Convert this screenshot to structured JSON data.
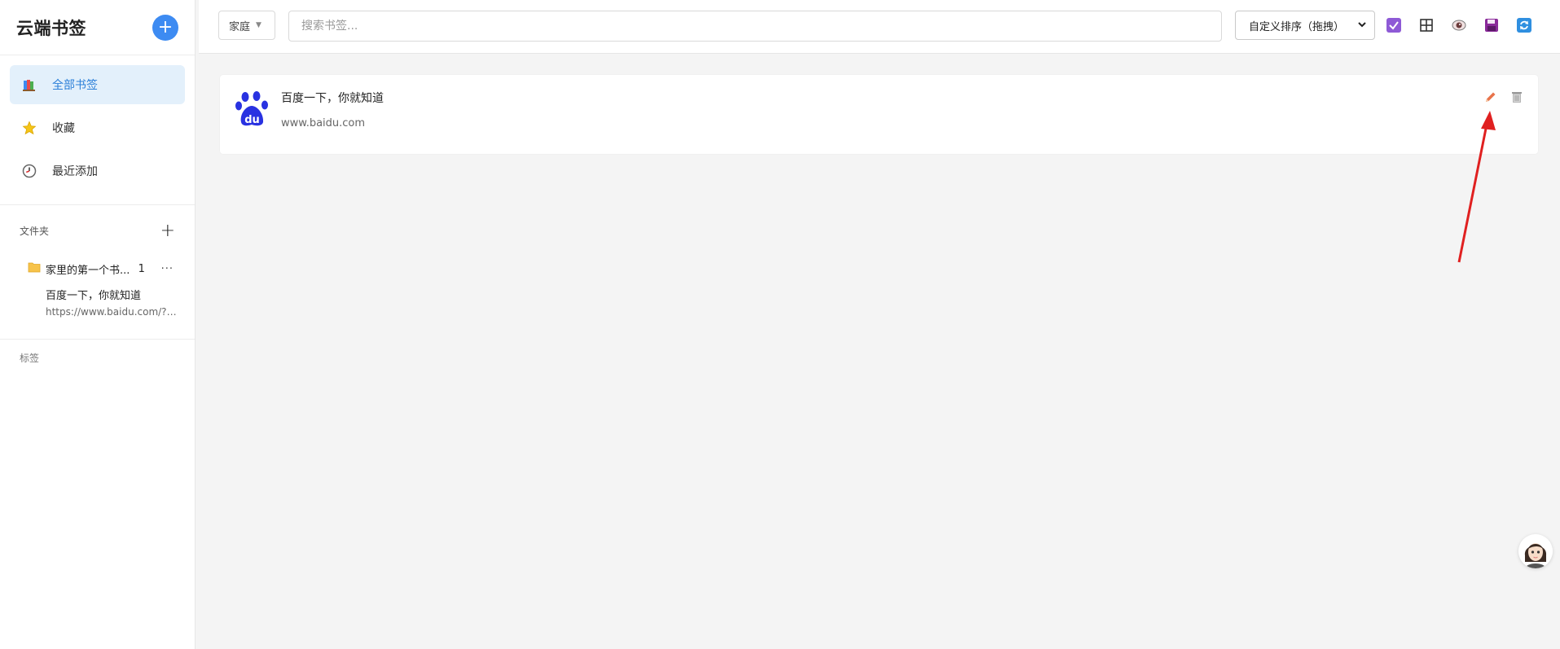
{
  "app": {
    "title": "云端书签"
  },
  "sidebar": {
    "nav": [
      {
        "label": "全部书签",
        "icon": "books-icon",
        "active": true
      },
      {
        "label": "收藏",
        "icon": "star-icon",
        "active": false
      },
      {
        "label": "最近添加",
        "icon": "clock-icon",
        "active": false
      }
    ],
    "folders_heading": "文件夹",
    "folders": [
      {
        "name": "家里的第一个书...",
        "count": "1",
        "bookmark": {
          "title": "百度一下，你就知道",
          "url": "https://www.baidu.com/?t..."
        }
      }
    ],
    "tags_heading": "标签"
  },
  "topbar": {
    "workspace": "家庭",
    "search_placeholder": "搜索书签...",
    "sort": "自定义排序（拖拽）",
    "tool_icons": [
      "checkbox-icon",
      "grid-icon",
      "eye-icon",
      "save-icon",
      "refresh-icon"
    ]
  },
  "bookmarks": [
    {
      "title": "百度一下，你就知道",
      "url": "www.baidu.com",
      "favicon": "baidu-paw-icon"
    }
  ],
  "colors": {
    "accent": "#3d8bf2",
    "active_bg": "#e3f0fb",
    "edit": "#e8734a",
    "annotation_arrow": "#e02020"
  }
}
